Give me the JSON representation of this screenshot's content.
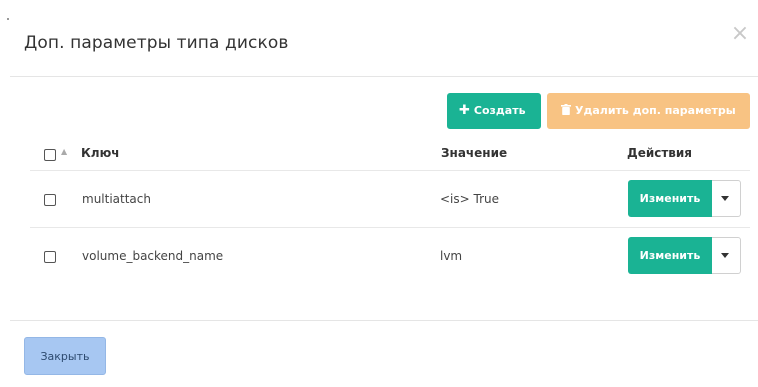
{
  "dialog": {
    "title": "Доп. параметры типа дисков",
    "close_symbol": "×"
  },
  "toolbar": {
    "create_label": "Создать",
    "create_icon": "plus-icon",
    "delete_label": "Удалить доп. параметры",
    "delete_icon": "trash-icon"
  },
  "table": {
    "columns": [
      "Ключ",
      "Значение",
      "Действия"
    ],
    "rows": [
      {
        "key": "multiattach",
        "value": "<is> True",
        "action_label": "Изменить"
      },
      {
        "key": "volume_backend_name",
        "value": "lvm",
        "action_label": "Изменить"
      }
    ]
  },
  "footer": {
    "close_label": "Закрыть"
  },
  "colors": {
    "primary": "#1ab394",
    "danger_disabled": "#f8c383",
    "close_button": "#a7c7f2"
  }
}
